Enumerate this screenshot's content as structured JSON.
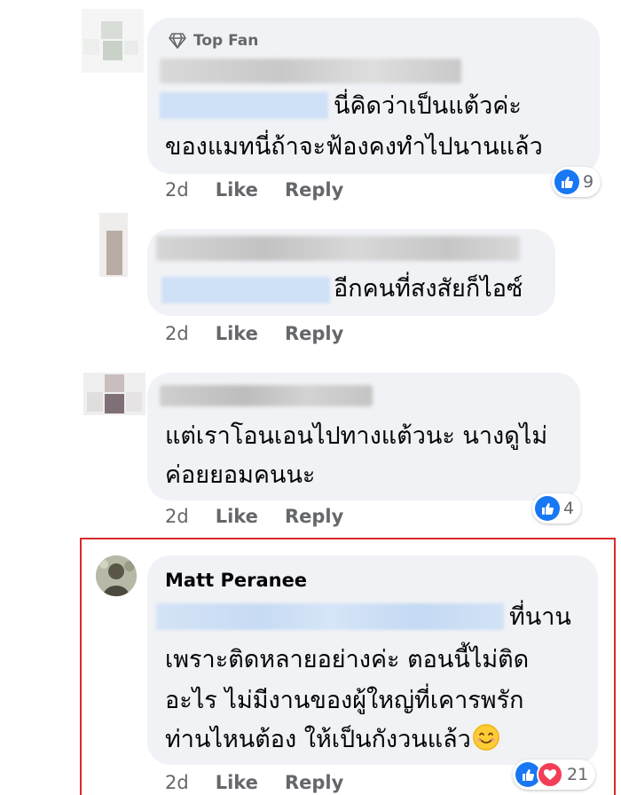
{
  "comments": [
    {
      "badge": "Top Fan",
      "lines": [
        "นี่คิดว่าเป็นแต้วค่ะ",
        "ของแมทนี่ถ้าจะฟ้องคงทำไปนานแล้ว"
      ],
      "time": "2d",
      "like_label": "Like",
      "reply_label": "Reply",
      "reaction_count": "9"
    },
    {
      "lines": [
        "อีกคนที่สงสัยก็ไอซ์"
      ],
      "time": "2d",
      "like_label": "Like",
      "reply_label": "Reply"
    },
    {
      "lines": [
        "แต่เราโอนเอนไปทางแต้วนะ นางดูไม่",
        "ค่อยยอมคนนะ"
      ],
      "time": "2d",
      "like_label": "Like",
      "reply_label": "Reply",
      "reaction_count": "4"
    },
    {
      "author": "Matt Peranee",
      "lines": [
        "ที่นาน",
        "เพราะติดหลายอย่างค่ะ ตอนนี้ไม่ติด",
        "อะไร ไม่มีงานของผู้ใหญ่ที่เคารพรัก",
        "ท่านไหนต้อง ให้เป็นกังวนแล้ว"
      ],
      "time": "2d",
      "like_label": "Like",
      "reply_label": "Reply",
      "reaction_count": "21"
    }
  ],
  "icons": [
    "diamond-icon",
    "like-icon",
    "love-icon",
    "smile-emoji"
  ],
  "colors": {
    "bubble": "#f0f2f5",
    "like_blue": "#1877f2",
    "love_red": "#f33e58",
    "highlight_border": "#d82a2a",
    "meta_gray": "#65676b"
  }
}
